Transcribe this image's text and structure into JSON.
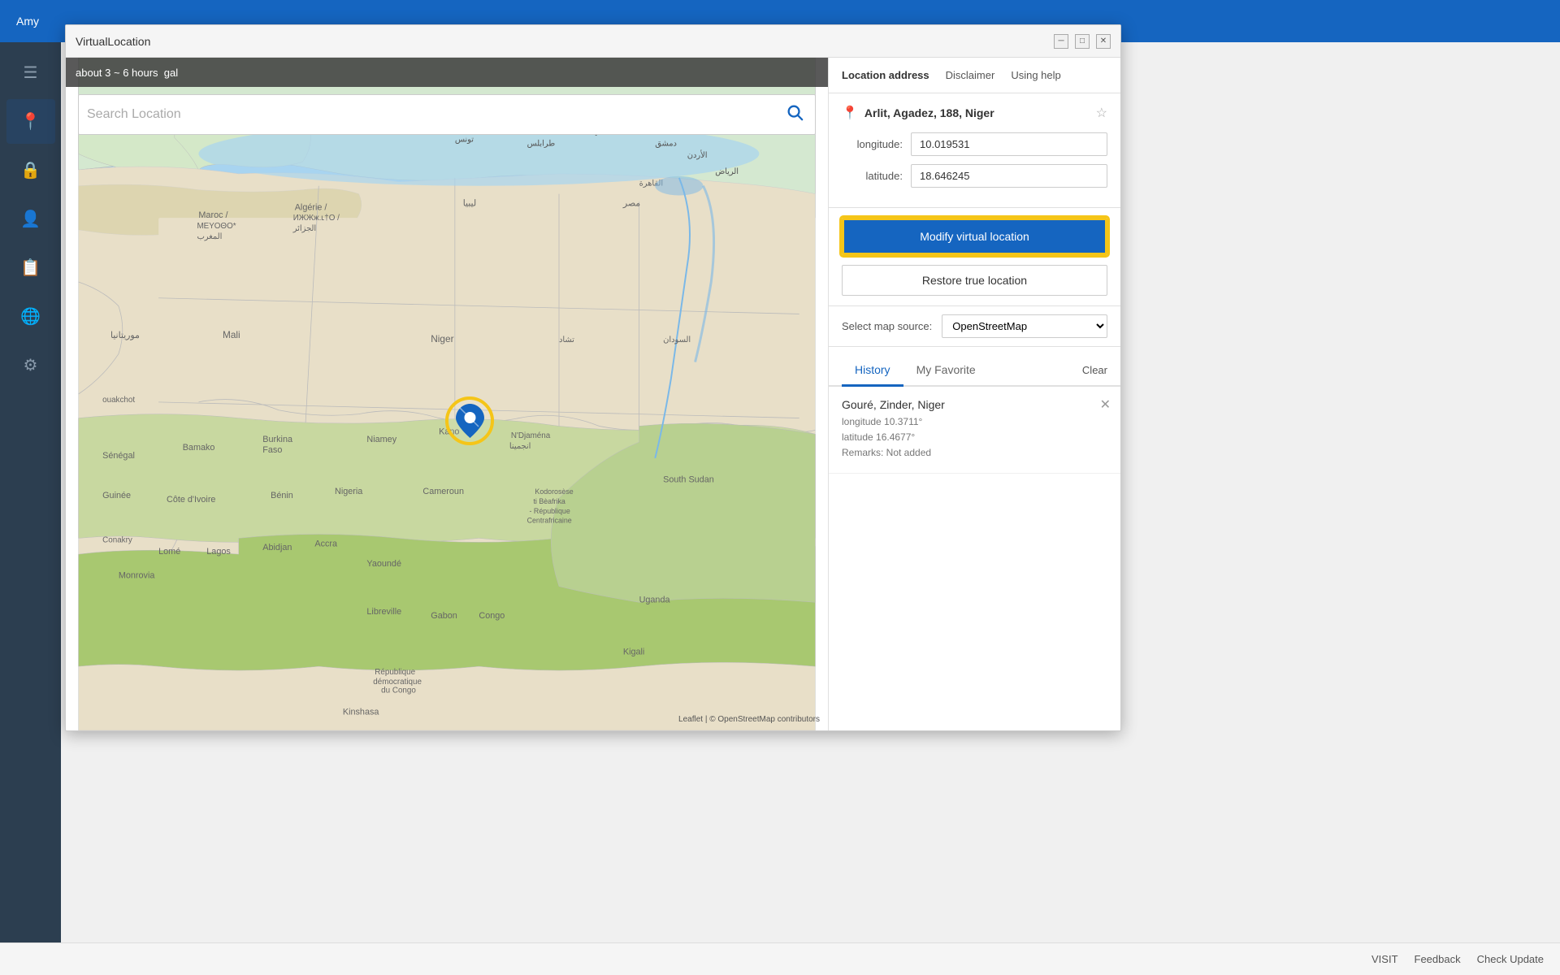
{
  "app": {
    "title": "Amy",
    "top_bar_color": "#1565c0"
  },
  "dialog": {
    "title": "VirtualLocation",
    "minimize_label": "─",
    "maximize_label": "□",
    "close_label": "✕"
  },
  "map": {
    "time_estimate": "about 3 ~ 6 hours",
    "search_placeholder": "Search Location",
    "attribution": "Leaflet | © OpenStreetMap contributors",
    "pin_location": "Niger region"
  },
  "panel": {
    "tabs": [
      {
        "label": "Location address",
        "active": true
      },
      {
        "label": "Disclaimer",
        "active": false
      },
      {
        "label": "Using help",
        "active": false
      }
    ],
    "location_name": "Arlit, Agadez, 188, Niger",
    "longitude_label": "longitude:",
    "longitude_value": "10.019531",
    "latitude_label": "latitude:",
    "latitude_value": "18.646245",
    "modify_btn_label": "Modify virtual location",
    "restore_btn_label": "Restore true location",
    "map_source_label": "Select map source:",
    "map_source_value": "OpenStreetMap"
  },
  "history": {
    "tab_history": "History",
    "tab_favorite": "My Favorite",
    "clear_label": "Clear",
    "items": [
      {
        "title": "Gouré, Zinder, Niger",
        "longitude": "longitude 10.3711°",
        "latitude": "latitude 16.4677°",
        "remarks": "Remarks: Not added"
      }
    ]
  },
  "bottom_bar": {
    "visit_label": "VISIT",
    "feedback_label": "Feedback",
    "check_update_label": "Check Update"
  },
  "sidebar": {
    "items": [
      {
        "icon": "☰",
        "name": "menu"
      },
      {
        "icon": "📍",
        "name": "location",
        "active": true
      },
      {
        "icon": "🔒",
        "name": "security"
      },
      {
        "icon": "👤",
        "name": "profile"
      },
      {
        "icon": "📋",
        "name": "clipboard"
      },
      {
        "icon": "🌐",
        "name": "network"
      },
      {
        "icon": "⚙",
        "name": "settings"
      }
    ]
  }
}
